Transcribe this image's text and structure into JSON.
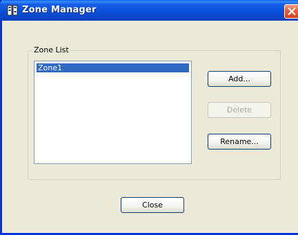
{
  "window": {
    "title": "Zone Manager",
    "icon": "app-icon",
    "close_icon": "close-icon"
  },
  "zone_list": {
    "group_label": "Zone List",
    "items": [
      {
        "label": "Zone1",
        "selected": true
      }
    ]
  },
  "buttons": {
    "add": {
      "label": "Add...",
      "enabled": true
    },
    "delete": {
      "label": "Delete",
      "enabled": false
    },
    "rename": {
      "label": "Rename...",
      "enabled": true
    },
    "close": {
      "label": "Close",
      "enabled": true
    }
  },
  "colors": {
    "title_bar": "#0a4fd8",
    "selection": "#316ac5",
    "window_background": "#ece9d8",
    "close_button": "#e4603b"
  }
}
